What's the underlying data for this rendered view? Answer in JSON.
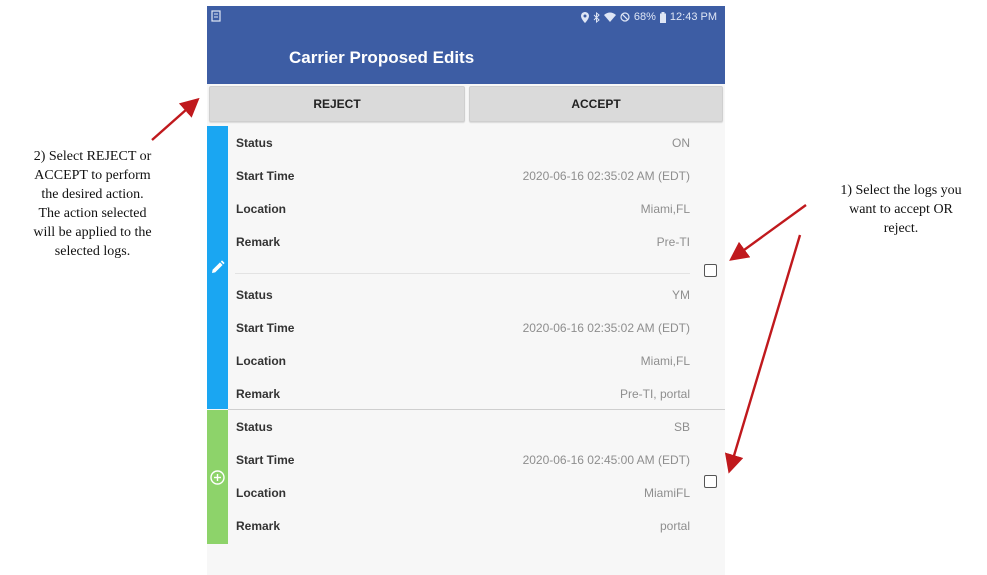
{
  "status_bar": {
    "battery": "68%",
    "time": "12:43 PM"
  },
  "app": {
    "title": "Carrier Proposed Edits"
  },
  "actions": {
    "reject_label": "REJECT",
    "accept_label": "ACCEPT"
  },
  "groups": [
    {
      "stripe_color": "#1aa6f2",
      "icon": "pencil-icon",
      "entries": [
        {
          "rows": [
            {
              "label": "Status",
              "value": "ON"
            },
            {
              "label": "Start Time",
              "value": "2020-06-16 02:35:02 AM (EDT)"
            },
            {
              "label": "Location",
              "value": "Miami,FL"
            },
            {
              "label": "Remark",
              "value": "Pre-TI"
            }
          ]
        },
        {
          "rows": [
            {
              "label": "Status",
              "value": "YM"
            },
            {
              "label": "Start Time",
              "value": "2020-06-16 02:35:02 AM (EDT)"
            },
            {
              "label": "Location",
              "value": "Miami,FL"
            },
            {
              "label": "Remark",
              "value": "Pre-TI, portal"
            }
          ]
        }
      ]
    },
    {
      "stripe_color": "#8dd36a",
      "icon": "plus-circle-icon",
      "entries": [
        {
          "rows": [
            {
              "label": "Status",
              "value": "SB"
            },
            {
              "label": "Start Time",
              "value": "2020-06-16 02:45:00 AM (EDT)"
            },
            {
              "label": "Location",
              "value": "MiamiFL"
            },
            {
              "label": "Remark",
              "value": "portal"
            }
          ]
        }
      ]
    }
  ],
  "annotations": {
    "left_note": [
      "2) Select REJECT or",
      "ACCEPT to perform",
      "the desired action.",
      "The action selected",
      "will be applied to the",
      "selected logs."
    ],
    "right_note": [
      "1) Select the logs you",
      "want to accept OR",
      "reject."
    ],
    "arrow_color": "#c0191d"
  }
}
